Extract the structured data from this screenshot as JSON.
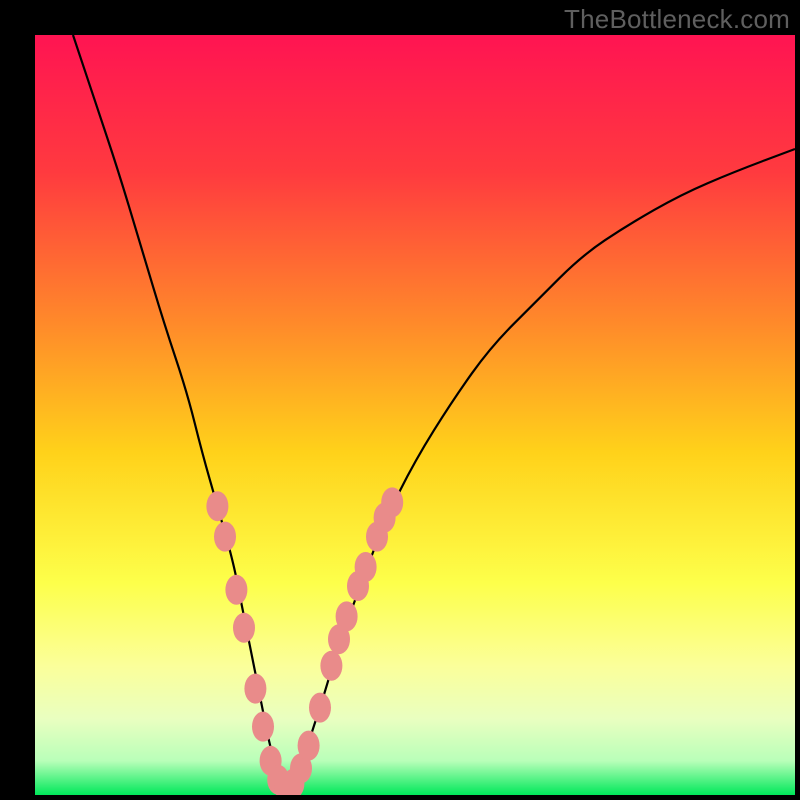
{
  "watermark": "TheBottleneck.com",
  "colors": {
    "bg_black": "#000000",
    "grad_top": "#ff1452",
    "grad_mid1": "#ff6b2f",
    "grad_mid2": "#ffd21a",
    "grad_low": "#fdff7a",
    "grad_pale": "#f4ffb0",
    "grad_bottom": "#00e85a",
    "curve": "#000000",
    "marker_fill": "#e98b8a",
    "marker_stroke": "#c96a68"
  },
  "chart_data": {
    "type": "line",
    "title": "",
    "xlabel": "",
    "ylabel": "",
    "xlim": [
      0,
      100
    ],
    "ylim": [
      0,
      100
    ],
    "series": [
      {
        "name": "bottleneck-curve",
        "x": [
          5,
          8,
          11,
          14,
          17,
          20,
          22,
          24,
          26,
          27,
          28,
          29,
          30,
          31,
          32,
          33,
          34,
          35,
          36,
          38,
          40,
          43,
          46,
          50,
          55,
          60,
          66,
          72,
          78,
          85,
          92,
          100
        ],
        "y": [
          100,
          91,
          82,
          72,
          62,
          53,
          45,
          38,
          31,
          26,
          21,
          16,
          11,
          6,
          3,
          1,
          1,
          3,
          7,
          13,
          20,
          28,
          36,
          44,
          52,
          59,
          65,
          71,
          75,
          79,
          82,
          85
        ]
      }
    ],
    "markers": [
      {
        "x": 24.0,
        "y": 38.0
      },
      {
        "x": 25.0,
        "y": 34.0
      },
      {
        "x": 26.5,
        "y": 27.0
      },
      {
        "x": 27.5,
        "y": 22.0
      },
      {
        "x": 29.0,
        "y": 14.0
      },
      {
        "x": 30.0,
        "y": 9.0
      },
      {
        "x": 31.0,
        "y": 4.5
      },
      {
        "x": 32.0,
        "y": 2.0
      },
      {
        "x": 33.0,
        "y": 1.0
      },
      {
        "x": 34.0,
        "y": 1.5
      },
      {
        "x": 35.0,
        "y": 3.5
      },
      {
        "x": 36.0,
        "y": 6.5
      },
      {
        "x": 37.5,
        "y": 11.5
      },
      {
        "x": 39.0,
        "y": 17.0
      },
      {
        "x": 40.0,
        "y": 20.5
      },
      {
        "x": 41.0,
        "y": 23.5
      },
      {
        "x": 42.5,
        "y": 27.5
      },
      {
        "x": 43.5,
        "y": 30.0
      },
      {
        "x": 45.0,
        "y": 34.0
      },
      {
        "x": 46.0,
        "y": 36.5
      },
      {
        "x": 47.0,
        "y": 38.5
      }
    ],
    "gradient_stops": [
      {
        "offset": 0.0,
        "color": "#ff1452"
      },
      {
        "offset": 0.18,
        "color": "#ff3a3f"
      },
      {
        "offset": 0.38,
        "color": "#ff8a2a"
      },
      {
        "offset": 0.55,
        "color": "#ffd21a"
      },
      {
        "offset": 0.72,
        "color": "#fdff4a"
      },
      {
        "offset": 0.83,
        "color": "#fbff9a"
      },
      {
        "offset": 0.9,
        "color": "#e9ffc0"
      },
      {
        "offset": 0.955,
        "color": "#b9ffb9"
      },
      {
        "offset": 1.0,
        "color": "#00e85a"
      }
    ]
  }
}
